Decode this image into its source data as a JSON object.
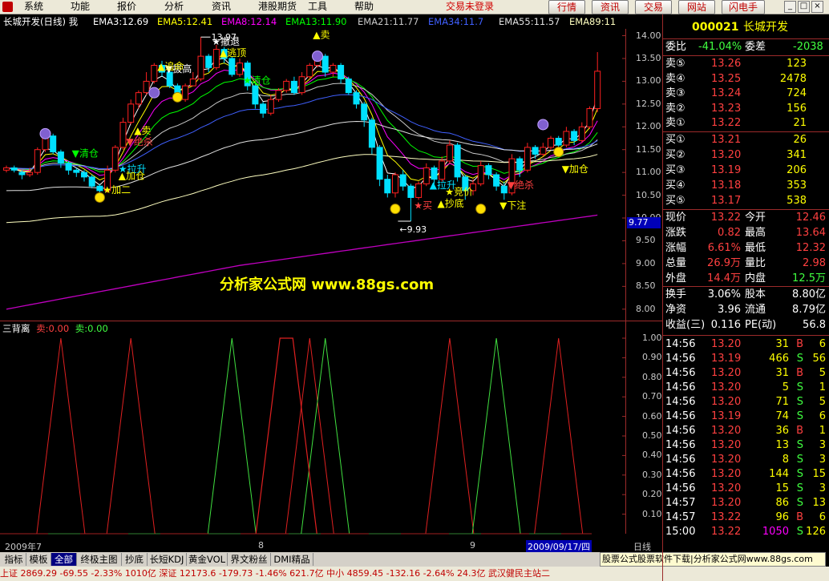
{
  "menubar": {
    "items": [
      "系统",
      "功能",
      "报价",
      "分析",
      "资讯",
      "港股期货",
      "工具",
      "帮助"
    ],
    "trade_status": "交易未登录",
    "toolbar_buttons": [
      "行情",
      "资讯",
      "交易",
      "网站",
      "闪电手"
    ],
    "window_buttons": [
      "_",
      "□",
      "×"
    ]
  },
  "chart": {
    "title": "长城开发(日线) 我",
    "ema_labels": [
      "EMA3:12.69",
      "EMA5:12.41",
      "EMA8:12.14",
      "EMA13:11.90",
      "EMA21:11.77",
      "EMA34:11.7",
      "EMA55:11.57",
      "EMA89:11"
    ],
    "ema_colors": [
      "#ffffff",
      "#ffff00",
      "#ff00ff",
      "#00ff00",
      "#c8c8c8",
      "#4060ff",
      "#e0e0e0",
      "#ffffc0"
    ],
    "y_ticks": [
      "14.00",
      "13.50",
      "13.00",
      "12.50",
      "12.00",
      "11.50",
      "11.00",
      "10.50",
      "10.00",
      "9.50",
      "9.00",
      "8.50",
      "8.00"
    ],
    "current_price_marker": "9.77",
    "watermark": "分析家公式网 www.88gs.com",
    "low_label": "9.93",
    "high_label": "13.97",
    "annotations": [
      "卖",
      "拉升",
      "清仓",
      "加仓",
      "加二",
      "绝杀",
      "逃顶",
      "撤退",
      "拔高",
      "追命",
      "买",
      "下注",
      "抄底",
      "竞价",
      "加仓",
      "拉升",
      "清仓",
      "绝杀",
      "卖"
    ]
  },
  "indicator": {
    "name": "三背离",
    "sell_label": "卖:0.00",
    "buy_label": "卖:0.00",
    "y_ticks": [
      "1.00",
      "0.90",
      "0.80",
      "0.70",
      "0.60",
      "0.50",
      "0.40",
      "0.30",
      "0.20",
      "0.10"
    ],
    "x_labels": [
      "2009年7",
      "8",
      "9",
      "2009/09/17/四"
    ],
    "axis_unit": "日线"
  },
  "tabs": [
    "指标",
    "模板",
    "全部",
    "终极主图",
    "抄底",
    "长短KDJ",
    "黄金VOL",
    "界文粉丝",
    "DMI精品"
  ],
  "selected_tab": "全部",
  "ad_banner": "股票公式股票软件下载|分析家公式网www.88gs.com",
  "statusbar": "上证 2869.29  -69.55  -2.33%  1010亿  深证 12173.6  -179.73  -1.46%  621.7亿  中小 4859.45  -132.16  -2.64%   24.3亿   武汉健民主站二",
  "quote": {
    "code": "000021",
    "name": "长城开发",
    "weibi_label": "委比",
    "weibi_value": "-41.04%",
    "weicha_label": "委差",
    "weicha_value": "-2038",
    "sells": [
      {
        "label": "卖⑤",
        "price": "13.26",
        "vol": "123"
      },
      {
        "label": "卖④",
        "price": "13.25",
        "vol": "2478"
      },
      {
        "label": "卖③",
        "price": "13.24",
        "vol": "724"
      },
      {
        "label": "卖②",
        "price": "13.23",
        "vol": "156"
      },
      {
        "label": "卖①",
        "price": "13.22",
        "vol": "21"
      }
    ],
    "buys": [
      {
        "label": "买①",
        "price": "13.21",
        "vol": "26"
      },
      {
        "label": "买②",
        "price": "13.20",
        "vol": "341"
      },
      {
        "label": "买③",
        "price": "13.19",
        "vol": "206"
      },
      {
        "label": "买④",
        "price": "13.18",
        "vol": "353"
      },
      {
        "label": "买⑤",
        "price": "13.17",
        "vol": "538"
      }
    ],
    "stats": [
      {
        "l1": "现价",
        "v1": "13.22",
        "l2": "今开",
        "v2": "12.46"
      },
      {
        "l1": "涨跌",
        "v1": "0.82",
        "l2": "最高",
        "v2": "13.64"
      },
      {
        "l1": "涨幅",
        "v1": "6.61%",
        "l2": "最低",
        "v2": "12.32"
      },
      {
        "l1": "总量",
        "v1": "26.9万",
        "l2": "量比",
        "v2": "2.98"
      },
      {
        "l1": "外盘",
        "v1": "14.4万",
        "l2": "内盘",
        "v2": "12.5万"
      }
    ],
    "fundamentals": [
      {
        "l1": "换手",
        "v1": "3.06%",
        "l2": "股本",
        "v2": "8.80亿"
      },
      {
        "l1": "净资",
        "v1": "3.96",
        "l2": "流通",
        "v2": "8.79亿"
      },
      {
        "l1": "收益(三)",
        "v1": "0.116",
        "l2": "PE(动)",
        "v2": "56.8"
      }
    ],
    "ticks": [
      {
        "time": "14:56",
        "price": "13.20",
        "vol": "31",
        "side": "B",
        "n": "6"
      },
      {
        "time": "14:56",
        "price": "13.19",
        "vol": "466",
        "side": "S",
        "n": "56"
      },
      {
        "time": "14:56",
        "price": "13.20",
        "vol": "31",
        "side": "B",
        "n": "5"
      },
      {
        "time": "14:56",
        "price": "13.20",
        "vol": "5",
        "side": "S",
        "n": "1"
      },
      {
        "time": "14:56",
        "price": "13.20",
        "vol": "71",
        "side": "S",
        "n": "5"
      },
      {
        "time": "14:56",
        "price": "13.19",
        "vol": "74",
        "side": "S",
        "n": "6"
      },
      {
        "time": "14:56",
        "price": "13.20",
        "vol": "36",
        "side": "B",
        "n": "1"
      },
      {
        "time": "14:56",
        "price": "13.20",
        "vol": "13",
        "side": "S",
        "n": "3"
      },
      {
        "time": "14:56",
        "price": "13.20",
        "vol": "8",
        "side": "S",
        "n": "3"
      },
      {
        "time": "14:56",
        "price": "13.20",
        "vol": "144",
        "side": "S",
        "n": "15"
      },
      {
        "time": "14:56",
        "price": "13.20",
        "vol": "15",
        "side": "S",
        "n": "3"
      },
      {
        "time": "14:57",
        "price": "13.20",
        "vol": "86",
        "side": "S",
        "n": "13"
      },
      {
        "time": "14:57",
        "price": "13.22",
        "vol": "96",
        "side": "B",
        "n": "6"
      },
      {
        "time": "15:00",
        "price": "13.22",
        "vol": "1050",
        "side": "S",
        "n": "126"
      }
    ]
  },
  "chart_data": {
    "type": "candlestick",
    "title": "长城开发(日线)",
    "ylim": [
      7.75,
      14.15
    ],
    "candles": [
      [
        11.05,
        11.1,
        11.15,
        11.0
      ],
      [
        11.1,
        11.05,
        11.15,
        11.0
      ],
      [
        11.0,
        10.95,
        11.05,
        10.85
      ],
      [
        10.95,
        11.0,
        11.1,
        10.9
      ],
      [
        11.0,
        11.5,
        11.55,
        10.95
      ],
      [
        11.5,
        11.8,
        11.9,
        11.45
      ],
      [
        11.8,
        11.45,
        11.85,
        11.4
      ],
      [
        11.45,
        11.2,
        11.5,
        11.1
      ],
      [
        11.2,
        11.05,
        11.25,
        10.95
      ],
      [
        11.05,
        11.0,
        11.1,
        10.9
      ],
      [
        11.0,
        10.9,
        11.05,
        10.8
      ],
      [
        10.9,
        10.7,
        10.95,
        10.65
      ],
      [
        10.7,
        10.6,
        10.75,
        10.55
      ],
      [
        10.6,
        11.05,
        11.15,
        10.55
      ],
      [
        11.05,
        11.55,
        11.6,
        11.0
      ],
      [
        11.55,
        12.1,
        12.2,
        11.5
      ],
      [
        12.1,
        12.5,
        12.6,
        12.05
      ],
      [
        12.5,
        12.75,
        12.8,
        12.4
      ],
      [
        12.75,
        13.0,
        13.2,
        12.7
      ],
      [
        13.0,
        13.35,
        13.4,
        12.95
      ],
      [
        13.35,
        13.2,
        13.45,
        13.1
      ],
      [
        13.2,
        12.9,
        13.25,
        12.85
      ],
      [
        12.9,
        12.6,
        12.95,
        12.55
      ],
      [
        12.6,
        12.9,
        12.95,
        12.55
      ],
      [
        12.9,
        13.05,
        13.2,
        12.9
      ],
      [
        13.05,
        13.55,
        13.97,
        13.0
      ],
      [
        13.55,
        13.3,
        13.6,
        13.2
      ],
      [
        13.3,
        13.7,
        13.8,
        13.25
      ],
      [
        13.7,
        13.5,
        13.75,
        13.4
      ],
      [
        13.5,
        13.15,
        13.55,
        13.1
      ],
      [
        13.15,
        13.4,
        13.5,
        13.1
      ],
      [
        13.4,
        12.9,
        13.45,
        12.8
      ],
      [
        12.9,
        12.5,
        12.95,
        12.4
      ],
      [
        12.5,
        12.3,
        12.55,
        12.2
      ],
      [
        12.3,
        12.6,
        12.7,
        12.25
      ],
      [
        12.6,
        12.8,
        12.85,
        12.55
      ],
      [
        12.8,
        13.0,
        13.05,
        12.75
      ],
      [
        13.0,
        12.75,
        13.1,
        12.7
      ],
      [
        12.75,
        13.1,
        13.2,
        12.7
      ],
      [
        13.1,
        13.35,
        13.4,
        13.05
      ],
      [
        13.35,
        13.55,
        13.6,
        13.3
      ],
      [
        13.55,
        13.2,
        13.6,
        13.1
      ],
      [
        13.2,
        13.35,
        13.4,
        13.1
      ],
      [
        13.35,
        13.05,
        13.4,
        12.95
      ],
      [
        13.05,
        12.75,
        13.1,
        12.7
      ],
      [
        12.75,
        12.5,
        12.8,
        12.4
      ],
      [
        12.5,
        12.15,
        12.55,
        12.0
      ],
      [
        12.15,
        11.55,
        12.2,
        11.4
      ],
      [
        11.55,
        10.85,
        11.6,
        10.7
      ],
      [
        10.85,
        10.55,
        10.95,
        10.45
      ],
      [
        10.55,
        10.95,
        11.0,
        10.45
      ],
      [
        10.95,
        10.7,
        11.05,
        10.6
      ],
      [
        10.7,
        10.45,
        10.75,
        9.93
      ],
      [
        10.45,
        10.75,
        10.8,
        10.4
      ],
      [
        10.75,
        11.1,
        11.2,
        10.7
      ],
      [
        11.1,
        10.85,
        11.15,
        10.75
      ],
      [
        10.85,
        11.25,
        11.35,
        10.8
      ],
      [
        11.25,
        11.6,
        11.7,
        11.2
      ],
      [
        11.6,
        10.9,
        11.65,
        10.8
      ],
      [
        10.9,
        10.6,
        10.95,
        10.4
      ],
      [
        10.6,
        10.75,
        10.85,
        10.5
      ],
      [
        10.75,
        11.15,
        11.25,
        10.7
      ],
      [
        11.15,
        10.95,
        11.2,
        10.85
      ],
      [
        10.95,
        10.7,
        11.0,
        10.6
      ],
      [
        10.7,
        10.55,
        10.8,
        10.4
      ],
      [
        10.55,
        11.3,
        11.4,
        10.5
      ],
      [
        11.3,
        11.05,
        11.35,
        10.9
      ],
      [
        11.05,
        11.55,
        11.65,
        11.0
      ],
      [
        11.55,
        11.4,
        11.6,
        11.3
      ],
      [
        11.4,
        11.55,
        11.65,
        11.35
      ],
      [
        11.55,
        11.75,
        11.8,
        11.5
      ],
      [
        11.75,
        11.6,
        11.8,
        11.5
      ],
      [
        11.6,
        11.9,
        12.0,
        11.55
      ],
      [
        11.9,
        11.7,
        11.95,
        11.6
      ],
      [
        11.7,
        12.0,
        12.1,
        11.65
      ],
      [
        12.0,
        12.4,
        12.45,
        11.95
      ],
      [
        12.4,
        13.22,
        13.64,
        12.32
      ]
    ],
    "indicator_spikes": [
      {
        "center": 7,
        "type": "sell"
      },
      {
        "center": 16,
        "type": "sell"
      },
      {
        "center": 29,
        "type": "buy"
      },
      {
        "center": 39,
        "type": "sell"
      },
      {
        "center": 41,
        "type": "buy"
      },
      {
        "center": 57,
        "type": "sell"
      },
      {
        "center": 63,
        "type": "buy"
      },
      {
        "center": 71,
        "type": "sell"
      }
    ]
  }
}
